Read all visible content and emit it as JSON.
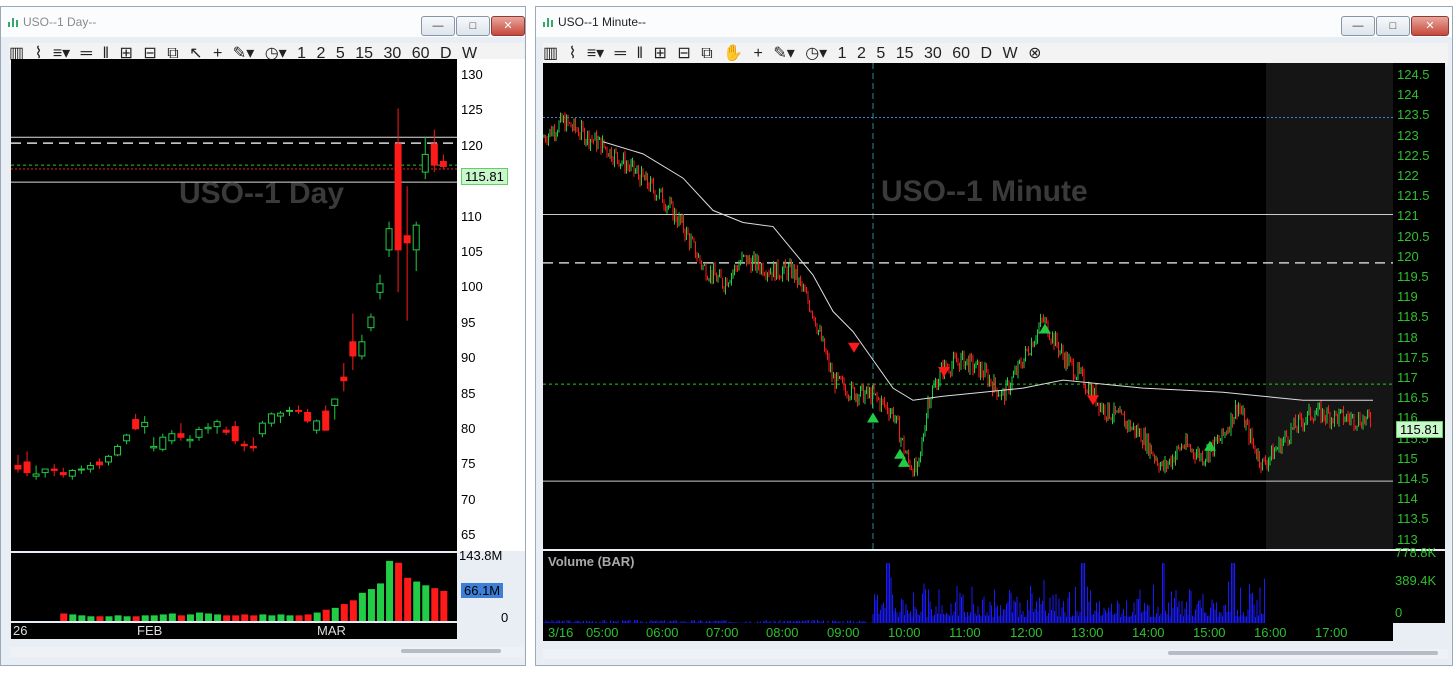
{
  "left_window": {
    "title": "USO--1 Day--",
    "watermark": "USO--1 Day",
    "price_tag": "115.81",
    "vol_max": "143.8M",
    "vol_tag": "66.1M",
    "vol_zero": "0",
    "price_ticks": [
      "130",
      "125",
      "120",
      "115",
      "110",
      "105",
      "100",
      "95",
      "90",
      "85",
      "80",
      "75",
      "70",
      "65"
    ],
    "x_labels": [
      "26",
      "FEB",
      "MAR"
    ]
  },
  "right_window": {
    "title": "USO--1 Minute--",
    "watermark": "USO--1 Minute",
    "price_tag": "115.81",
    "volume_label": "Volume (BAR)",
    "vol_ticks": [
      "778.8K",
      "389.4K",
      "0"
    ],
    "price_ticks": [
      "124.5",
      "124",
      "123.5",
      "123",
      "122.5",
      "122",
      "121.5",
      "121",
      "120.5",
      "120",
      "119.5",
      "119",
      "118.5",
      "118",
      "117.5",
      "117",
      "116.5",
      "116",
      "115.5",
      "115",
      "114.5",
      "114",
      "113.5",
      "113"
    ],
    "x_labels": [
      "3/16",
      "05:00",
      "06:00",
      "07:00",
      "08:00",
      "09:00",
      "10:00",
      "11:00",
      "12:00",
      "13:00",
      "14:00",
      "15:00",
      "16:00",
      "17:00"
    ]
  },
  "toolbar": {
    "intervals": [
      "1",
      "2",
      "5",
      "15",
      "30",
      "60",
      "D",
      "W"
    ]
  },
  "window_buttons": {
    "minimize": "—",
    "maximize": "□",
    "close": "✕"
  },
  "colors": {
    "up": "#22cc44",
    "down": "#ff1a1a",
    "axis_green": "#2fbf2f",
    "volume_blue": "#1a1aff",
    "background": "#000000"
  }
}
